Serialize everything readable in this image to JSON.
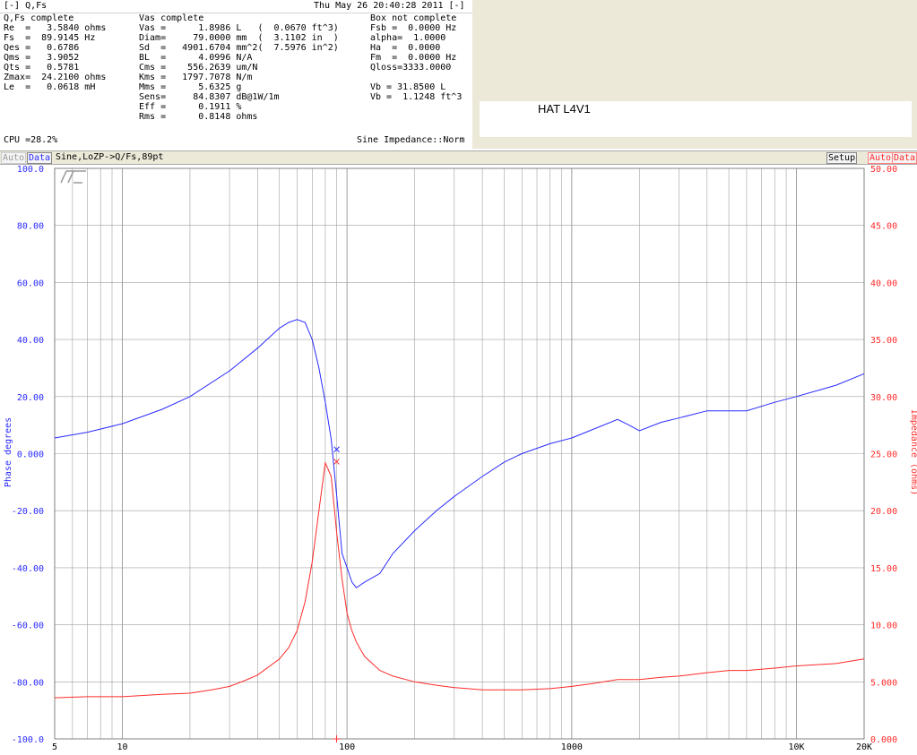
{
  "params": {
    "window_label": "[-] Q,Fs",
    "datetime": "Thu May 26 20:40:28 2011 [-]",
    "col1": {
      "header": "Q,Fs complete",
      "lines": [
        "Re  =   3.5840 ohms",
        "Fs  =  89.9145 Hz",
        "Qes =   0.6786",
        "Qms =   3.9052",
        "Qts =   0.5781",
        "Zmax=  24.2100 ohms",
        "Le  =   0.0618 mH"
      ],
      "cpu": "CPU =28.2%"
    },
    "col2": {
      "header": "Vas complete",
      "lines": [
        "Vas =      1.8986 L   (  0.0670 ft^3)",
        "Diam=     79.0000 mm  (  3.1102 in  )",
        "Sd  =   4901.6704 mm^2(  7.5976 in^2)",
        "BL  =      4.0996 N/A",
        "Cms =    556.2639 um/N",
        "Kms =   1797.7078 N/m",
        "Mms =      5.6325 g",
        "Sens=     84.8307 dB@1W/1m",
        "Eff =      0.1911 %",
        "Rms =      0.8148 ohms"
      ]
    },
    "col3": {
      "header": "Box not complete",
      "lines": [
        "Fsb =  0.0000 Hz",
        "alpha=  1.0000",
        "Ha  =  0.0000",
        "Fm  =  0.0000 Hz",
        "Qloss=3333.0000",
        "",
        "Vb = 31.8500 L",
        "Vb =  1.1248 ft^3"
      ],
      "footer": "Sine Impedance::Norm"
    }
  },
  "hat_label": "HAT L4V1",
  "toolbar": {
    "auto_left": "Auto",
    "data_left": "Data",
    "measurement": "Sine,LoZP->Q/Fs,89pt",
    "setup": "Setup",
    "auto_right": "Auto",
    "data_right": "Data"
  },
  "colors": {
    "phase": "#2a2aff",
    "impedance": "#ff2a2a",
    "grid": "#a0a0a0"
  },
  "chart_data": {
    "type": "line",
    "xscale": "log",
    "xlim": [
      5,
      20000
    ],
    "x_tick_labels": [
      "5",
      "10",
      "100",
      "1000",
      "10K",
      "20K"
    ],
    "x_tick_values": [
      5,
      10,
      100,
      1000,
      10000,
      20000
    ],
    "y_left": {
      "label": "Phase degrees",
      "lim": [
        -100,
        100
      ],
      "ticks": [
        100,
        80,
        60,
        40,
        20,
        0,
        -20,
        -40,
        -60,
        -80,
        -100
      ],
      "tick_labels": [
        "100.0",
        "80.00",
        "60.00",
        "40.00",
        "20.00",
        "0.000",
        "-20.00",
        "-40.00",
        "-60.00",
        "-80.00",
        "-100.0"
      ]
    },
    "y_right": {
      "label": "Impedance (ohms)",
      "lim": [
        0,
        50
      ],
      "ticks": [
        50,
        45,
        40,
        35,
        30,
        25,
        20,
        15,
        10,
        5,
        0
      ],
      "tick_labels": [
        "50.00",
        "45.00",
        "40.00",
        "35.00",
        "30.00",
        "25.00",
        "20.00",
        "15.00",
        "10.00",
        "5.000",
        "0.000"
      ]
    },
    "series": [
      {
        "axis": "left",
        "color": "#2a2aff",
        "x": [
          5,
          7,
          10,
          15,
          20,
          30,
          40,
          50,
          55,
          60,
          65,
          70,
          75,
          80,
          85,
          90,
          95,
          100,
          105,
          110,
          115,
          120,
          140,
          160,
          200,
          250,
          300,
          400,
          500,
          600,
          800,
          1000,
          1200,
          1600,
          1800,
          2000,
          2500,
          3000,
          4000,
          5000,
          6000,
          8000,
          10000,
          15000,
          20000
        ],
        "y": [
          5.5,
          7.5,
          10.5,
          15.5,
          20,
          29,
          37,
          44,
          46,
          47,
          46,
          40,
          30,
          18,
          5,
          -15,
          -35,
          -40,
          -45,
          -47,
          -46,
          -45,
          -42,
          -35,
          -27,
          -20,
          -15,
          -8,
          -3,
          0,
          3.5,
          5.5,
          8,
          12,
          10,
          8,
          11,
          12.5,
          15,
          15,
          15,
          18,
          20,
          24,
          28
        ]
      },
      {
        "axis": "right",
        "color": "#ff2a2a",
        "x": [
          5,
          7,
          10,
          15,
          20,
          25,
          30,
          35,
          40,
          50,
          55,
          60,
          65,
          70,
          75,
          80,
          85,
          90,
          95,
          100,
          105,
          110,
          115,
          120,
          140,
          160,
          200,
          250,
          300,
          400,
          500,
          600,
          800,
          1000,
          1200,
          1600,
          2000,
          2500,
          3000,
          4000,
          5000,
          6000,
          8000,
          10000,
          15000,
          20000
        ],
        "y": [
          3.6,
          3.7,
          3.7,
          3.9,
          4.0,
          4.3,
          4.6,
          5.1,
          5.6,
          7.0,
          8.0,
          9.5,
          12,
          15.5,
          20,
          24.2,
          23,
          18,
          14,
          11,
          9.5,
          8.5,
          7.8,
          7.2,
          6.0,
          5.5,
          5.0,
          4.7,
          4.5,
          4.3,
          4.3,
          4.3,
          4.4,
          4.6,
          4.8,
          5.2,
          5.2,
          5.4,
          5.5,
          5.8,
          6.0,
          6.0,
          6.2,
          6.4,
          6.6,
          7.0
        ]
      }
    ],
    "markers": [
      {
        "axis": "left",
        "x": 89.9,
        "y": 1.5,
        "color": "#2a2aff",
        "symbol": "x"
      },
      {
        "axis": "right",
        "x": 89.9,
        "y": 24.3,
        "color": "#ff2a2a",
        "symbol": "x"
      }
    ]
  }
}
